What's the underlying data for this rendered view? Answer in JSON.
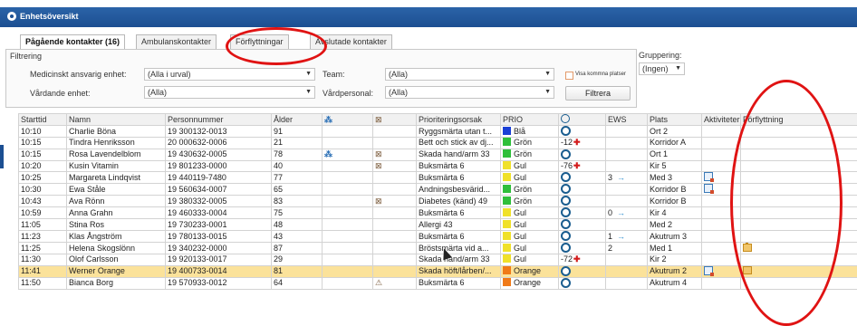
{
  "window": {
    "title": "Enhetsöversikt"
  },
  "tabs": [
    {
      "label": "Pågående kontakter (16)",
      "active": true
    },
    {
      "label": "Ambulanskontakter",
      "active": false
    },
    {
      "label": "Förflyttningar",
      "active": false
    },
    {
      "label": "Avslutade kontakter",
      "active": false
    }
  ],
  "filter": {
    "title": "Filtrering",
    "medical_unit_label": "Medicinskt ansvarig enhet:",
    "medical_unit_value": "(Alla i urval)",
    "care_unit_label": "Vårdande enhet:",
    "care_unit_value": "(Alla)",
    "team_label": "Team:",
    "team_value": "(Alla)",
    "staff_label": "Vårdpersonal:",
    "staff_value": "(Alla)",
    "show_upcoming_label": "Visa kommna platser",
    "show_upcoming_checked": false,
    "filter_button": "Filtrera"
  },
  "grouping": {
    "label": "Gruppering:",
    "value": "(Ingen)"
  },
  "columns": [
    "Starttid",
    "Namn",
    "Personnummer",
    "Ålder",
    "",
    "",
    "Prioriteringsorsak",
    "PRIO",
    "",
    "EWS",
    "Plats",
    "Aktiviteter",
    "Förflyttning"
  ],
  "priority_colors": {
    "Blå": "#1a3fd6",
    "Grön": "#2fbf3a",
    "Gul": "#f0e12a",
    "Orange": "#f07a18"
  },
  "rows": [
    {
      "start": "10:10",
      "name": "Charlie Böna",
      "pnr": "19 300132-0013",
      "age": "91",
      "c5": "",
      "c6": "",
      "reason": "Ryggsmärta utan t...",
      "prio": "Blå",
      "status": "circle",
      "ews": "",
      "ews_arrow": "",
      "place": "Ort 2",
      "activity": false,
      "move": false,
      "selected": false
    },
    {
      "start": "10:15",
      "name": "Tindra Henriksson",
      "pnr": "20 000632-0006",
      "age": "21",
      "c5": "",
      "c6": "",
      "reason": "Bett och stick av dj...",
      "prio": "Grön",
      "status": "-12",
      "ews": "",
      "ews_arrow": "",
      "place": "Korridor A",
      "activity": false,
      "move": false,
      "selected": false
    },
    {
      "start": "10:15",
      "name": "Rosa Lavendelblom",
      "pnr": "19 430632-0005",
      "age": "78",
      "c5": "glyph-a",
      "c6": "glyph-b",
      "reason": "Skada hand/arm 33",
      "prio": "Grön",
      "status": "circle",
      "ews": "",
      "ews_arrow": "",
      "place": "Ort 1",
      "activity": false,
      "move": false,
      "selected": false
    },
    {
      "start": "10:20",
      "name": "Kusin Vitamin",
      "pnr": "19 801233-0000",
      "age": "40",
      "c5": "",
      "c6": "glyph-b",
      "reason": "Buksmärta 6",
      "prio": "Gul",
      "status": "-76",
      "ews": "",
      "ews_arrow": "",
      "place": "Kir 5",
      "activity": false,
      "move": false,
      "selected": false
    },
    {
      "start": "10:25",
      "name": "Margareta Lindqvist",
      "pnr": "19 440119-7480",
      "age": "77",
      "c5": "",
      "c6": "",
      "reason": "Buksmärta 6",
      "prio": "Gul",
      "status": "circle",
      "ews": "3",
      "ews_arrow": "→",
      "place": "Med 3",
      "activity": true,
      "move": false,
      "selected": false
    },
    {
      "start": "10:30",
      "name": "Ewa Ståle",
      "pnr": "19 560634-0007",
      "age": "65",
      "c5": "",
      "c6": "",
      "reason": "Andningsbesvärid...",
      "prio": "Grön",
      "status": "circle",
      "ews": "",
      "ews_arrow": "",
      "place": "Korridor B",
      "activity": true,
      "move": false,
      "selected": false
    },
    {
      "start": "10:43",
      "name": "Ava Rönn",
      "pnr": "19 380332-0005",
      "age": "83",
      "c5": "",
      "c6": "glyph-b",
      "reason": "Diabetes (känd) 49",
      "prio": "Grön",
      "status": "circle",
      "ews": "",
      "ews_arrow": "",
      "place": "Korridor B",
      "activity": false,
      "move": false,
      "selected": false
    },
    {
      "start": "10:59",
      "name": "Anna Grahn",
      "pnr": "19 460333-0004",
      "age": "75",
      "c5": "",
      "c6": "",
      "reason": "Buksmärta 6",
      "prio": "Gul",
      "status": "circle",
      "ews": "0",
      "ews_arrow": "→",
      "place": "Kir 4",
      "activity": false,
      "move": false,
      "selected": false
    },
    {
      "start": "11:05",
      "name": "Stina Ros",
      "pnr": "19 730233-0001",
      "age": "48",
      "c5": "",
      "c6": "",
      "reason": "Allergi 43",
      "prio": "Gul",
      "status": "circle",
      "ews": "",
      "ews_arrow": "",
      "place": "Med 2",
      "activity": false,
      "move": false,
      "selected": false
    },
    {
      "start": "11:23",
      "name": "Klas Ångström",
      "pnr": "19 780133-0015",
      "age": "43",
      "c5": "",
      "c6": "",
      "reason": "Buksmärta 6",
      "prio": "Gul",
      "status": "circle",
      "ews": "1",
      "ews_arrow": "→",
      "place": "Akutrum 3",
      "activity": false,
      "move": false,
      "selected": false
    },
    {
      "start": "11:25",
      "name": "Helena Skogslönn",
      "pnr": "19 340232-0000",
      "age": "87",
      "c5": "",
      "c6": "",
      "reason": "Bröstsmärta vid a...",
      "prio": "Gul",
      "status": "circle",
      "ews": "2",
      "ews_arrow": "",
      "place": "Med 1",
      "activity": false,
      "move": true,
      "selected": false
    },
    {
      "start": "11:30",
      "name": "Olof Carlsson",
      "pnr": "19 920133-0017",
      "age": "29",
      "c5": "",
      "c6": "",
      "reason": "Skada hand/arm 33",
      "prio": "Gul",
      "status": "-72",
      "ews": "",
      "ews_arrow": "",
      "place": "Kir 2",
      "activity": false,
      "move": false,
      "selected": false
    },
    {
      "start": "11:41",
      "name": "Werner Orange",
      "pnr": "19 400733-0014",
      "age": "81",
      "c5": "",
      "c6": "",
      "reason": "Skada höft/lårben/...",
      "prio": "Orange",
      "status": "circle",
      "ews": "",
      "ews_arrow": "",
      "place": "Akutrum 2",
      "activity": true,
      "move": true,
      "selected": true
    },
    {
      "start": "11:50",
      "name": "Bianca Borg",
      "pnr": "19 570933-0012",
      "age": "64",
      "c5": "",
      "c6": "glyph-c",
      "reason": "Buksmärta 6",
      "prio": "Orange",
      "status": "circle",
      "ews": "",
      "ews_arrow": "",
      "place": "Akutrum 4",
      "activity": false,
      "move": false,
      "selected": false
    }
  ]
}
